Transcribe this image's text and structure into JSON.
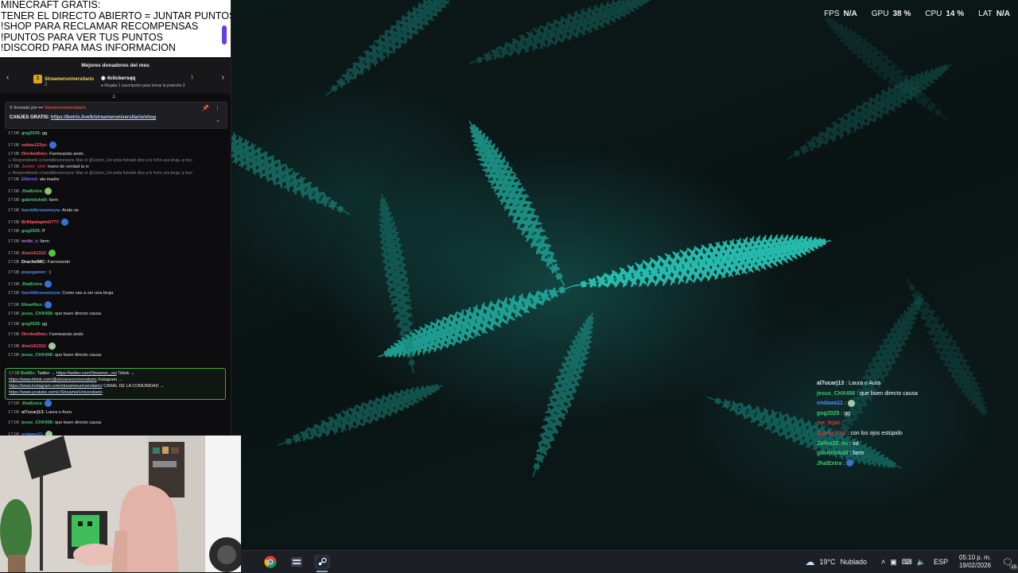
{
  "stats": [
    {
      "label": "FPS",
      "value": "N/A"
    },
    {
      "label": "GPU",
      "value": "38 %"
    },
    {
      "label": "CPU",
      "value": "14 %"
    },
    {
      "label": "LAT",
      "value": "N/A"
    }
  ],
  "banner": {
    "lines": [
      "MINECRAFT GRATIS:",
      "TENER EL DIRECTO ABIERTO = JUNTAR PUNTOS",
      "!SHOP PARA RECLAMAR RECOMPENSAS",
      "!PUNTOS PARA VER TUS PUNTOS",
      "!DISCORD PARA MAS INFORMACION"
    ]
  },
  "donors": {
    "title": "Mejores donadores del mes",
    "first_name": "Streameruniversitario",
    "first_rank": "1",
    "first_count": "2",
    "second_name": "4clickersqq",
    "second_count": "1",
    "subtitle": "Regala 1 suscripción para tomar la posición 3"
  },
  "pinned": {
    "sent_by": "Enviado por",
    "sender": "Streameruniversitario",
    "message_prefix": "CANJES GRATIS:",
    "link": "https://botrix.live/k/streameruniversitario/shop"
  },
  "chat": [
    {
      "time": "17:08",
      "user": "gog2025:",
      "color": "#3fc86e",
      "text": "gg",
      "emote": null
    },
    {
      "time": "17:08",
      "user": "sebas123yz:",
      "color": "#ff5a6e",
      "text": "",
      "emote": "#3a6fd8"
    },
    {
      "time": "17:08",
      "user": "f3rn4nd0mc:",
      "color": "#ff5a6e",
      "text": "Farmeando ando",
      "emote": null
    },
    {
      "reply": "Respondiendo a haroldbrunoneyra: Man el @Junior_Uni anda fumado dice q lo hcho una bruja, q loco"
    },
    {
      "time": "17:08",
      "user": "Junior_Uni:",
      "color": "#e03040",
      "text": "mano de verdad la vi",
      "emote": null
    },
    {
      "reply": "Respondiendo a haroldbrunoneyra: Man el @Junior_Uni anda fumado dice q lo hcho una bruja, q loco"
    },
    {
      "time": "17:08",
      "user": "Elfernd:",
      "color": "#8a5cff",
      "text": "ala madre",
      "emote": null
    },
    {
      "time": "17:08",
      "user": "JhalExtra:",
      "color": "#3fc86e",
      "text": "",
      "emote": "#8fbf6a"
    },
    {
      "time": "17:08",
      "user": "gabrielckdd:",
      "color": "#3fc86e",
      "text": "farm",
      "emote": null
    },
    {
      "time": "17:08",
      "user": "haroldbrunoneyra:",
      "color": "#4a8cff",
      "text": "Anda oe",
      "emote": null
    },
    {
      "time": "17:08",
      "user": "Br84patapim0777:",
      "color": "#ff5a6e",
      "text": "",
      "emote": "#3a6fd8"
    },
    {
      "time": "17:08",
      "user": "gog2025:",
      "color": "#3fc86e",
      "text": "ff",
      "emote": null
    },
    {
      "time": "17:08",
      "user": "toribi_c:",
      "color": "#b07ae0",
      "text": "farm",
      "emote": null
    },
    {
      "time": "17:08",
      "user": "dios141312:",
      "color": "#ff5a6e",
      "text": "",
      "emote": "#4cc93a"
    },
    {
      "time": "17:08",
      "user": "DrachelMC:",
      "color": "#e8e8e8",
      "text": "Farmeando",
      "emote": null
    },
    {
      "time": "17:08",
      "user": "popegamer:",
      "color": "#4a8cff",
      "text": ":)",
      "emote": null
    },
    {
      "time": "17:08",
      "user": "JhalExtra:",
      "color": "#3fc86e",
      "text": "",
      "emote": "#3a6fd8"
    },
    {
      "time": "17:08",
      "user": "haroldbrunoneyra:",
      "color": "#4a8cff",
      "text": "Como vas a ver una bruja",
      "emote": null
    },
    {
      "time": "17:08",
      "user": "ElwarNux:",
      "color": "#3fc86e",
      "text": "",
      "emote": "#3a6fd8"
    },
    {
      "time": "17:08",
      "user": "jesus_CHX458:",
      "color": "#3fc86e",
      "text": "que buen directo causa",
      "emote": null
    },
    {
      "time": "17:08",
      "user": "gog2025:",
      "color": "#3fc86e",
      "text": "gg",
      "emote": null
    },
    {
      "time": "17:08",
      "user": "f3rn4nd0mc:",
      "color": "#ff5a6e",
      "text": "Farmeando ando",
      "emote": null
    },
    {
      "time": "17:08",
      "user": "dios141312:",
      "color": "#ff5a6e",
      "text": "",
      "emote": "#a0c8a0"
    },
    {
      "time": "17:08",
      "user": "jesus_CHX458:",
      "color": "#3fc86e",
      "text": "que buen directo causa",
      "emote": null
    }
  ],
  "botrix": {
    "time": "17:08",
    "user": "BotRix:",
    "line1_prefix": "Twitter →",
    "twitter": "https://twitter.com/Streamer_uni",
    "line1_suffix": "Tiktok →",
    "tiktok": "https://www.tiktok.com/@streameruniversitario",
    "line2_suffix": "Instagram →",
    "instagram": "https://www.instagram.com/streameruniversitario/",
    "line3_suffix": "CANAL DE LA COMUNIDAD →",
    "youtube": "https://www.youtube.com/c/StreamerUniversitario"
  },
  "chat_bottom": [
    {
      "time": "17:09",
      "user": "JhalExtra:",
      "color": "#3fc86e",
      "text": "",
      "emote": "#3a6fd8"
    },
    {
      "time": "17:09",
      "user": "al7ucarj13:",
      "color": "#cfcfcf",
      "text": "Laura o Aura",
      "emote": null
    },
    {
      "time": "17:09",
      "user": "jesus_CHX458:",
      "color": "#3fc86e",
      "text": "que buen directo causa",
      "emote": null
    },
    {
      "time": "17:09",
      "user": "endawa11:",
      "color": "#4a8cff",
      "text": "",
      "emote": "#a0c8a0"
    }
  ],
  "overlay": [
    {
      "user": "al7ucarj13",
      "color": "#e8e8e8",
      "text": "Laura o Aura",
      "emote": null
    },
    {
      "user": "jesus_CHX456",
      "color": "#3fc86e",
      "text": "que buen directo causa",
      "emote": null
    },
    {
      "user": "endawa11",
      "color": "#4a8cff",
      "text": "",
      "emote": "#a0c8a0"
    },
    {
      "user": "gog2025",
      "color": "#3fc86e",
      "text": "gg",
      "emote": null
    },
    {
      "user": "me_lejan",
      "color": "#e03040",
      "text": "",
      "emote": null
    },
    {
      "user": "Junior_Uni",
      "color": "#e03040",
      "text": "con los ojos estúpido",
      "emote": null
    },
    {
      "user": "Zafiro25_os",
      "color": "#3fc86e",
      "text": "xd",
      "emote": null
    },
    {
      "user": "gabrielckdd",
      "color": "#3fc86e",
      "text": "farm",
      "emote": null
    },
    {
      "user": "JhalExtra",
      "color": "#3fc86e",
      "text": "",
      "emote": "#3a6fd8"
    }
  ],
  "taskbar": {
    "weather_temp": "19°C",
    "weather_text": "Nublado",
    "language": "ESP",
    "time": "05:10 p. m.",
    "date": "19/02/2026",
    "notification_count": "15",
    "apps": [
      "chrome-icon",
      "app-icon",
      "steam-icon"
    ]
  }
}
